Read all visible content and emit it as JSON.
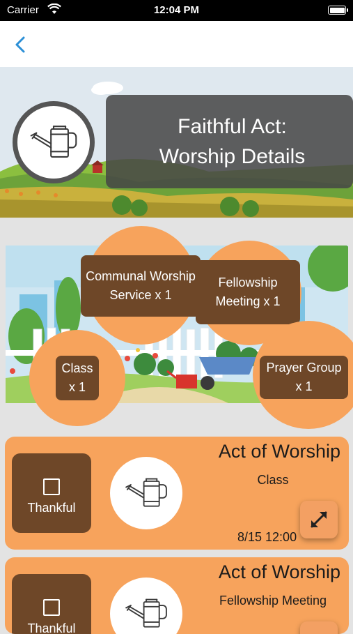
{
  "status_bar": {
    "carrier": "Carrier",
    "time": "12:04 PM"
  },
  "header": {
    "title_line1": "Faithful Act:",
    "title_line2": "Worship Details"
  },
  "bubbles": [
    {
      "label": "Communal Worship Service x 1"
    },
    {
      "label": "Fellowship Meeting x 1"
    },
    {
      "label": "Class x 1"
    },
    {
      "label": "Prayer Group x 1"
    }
  ],
  "cards": [
    {
      "title": "Act of Worship",
      "subtitle": "Class",
      "thank_label": "Thankful",
      "date": "8/15 12:00"
    },
    {
      "title": "Act of Worship",
      "subtitle": "Fellowship Meeting",
      "thank_label": "Thankful"
    }
  ],
  "colors": {
    "accent": "#f7a35c",
    "label_bg": "#6e4728",
    "back": "#2c8fd6"
  },
  "icons": {
    "back": "chevron-left-icon",
    "badge": "watering-can-icon",
    "expand": "expand-arrows-icon"
  }
}
